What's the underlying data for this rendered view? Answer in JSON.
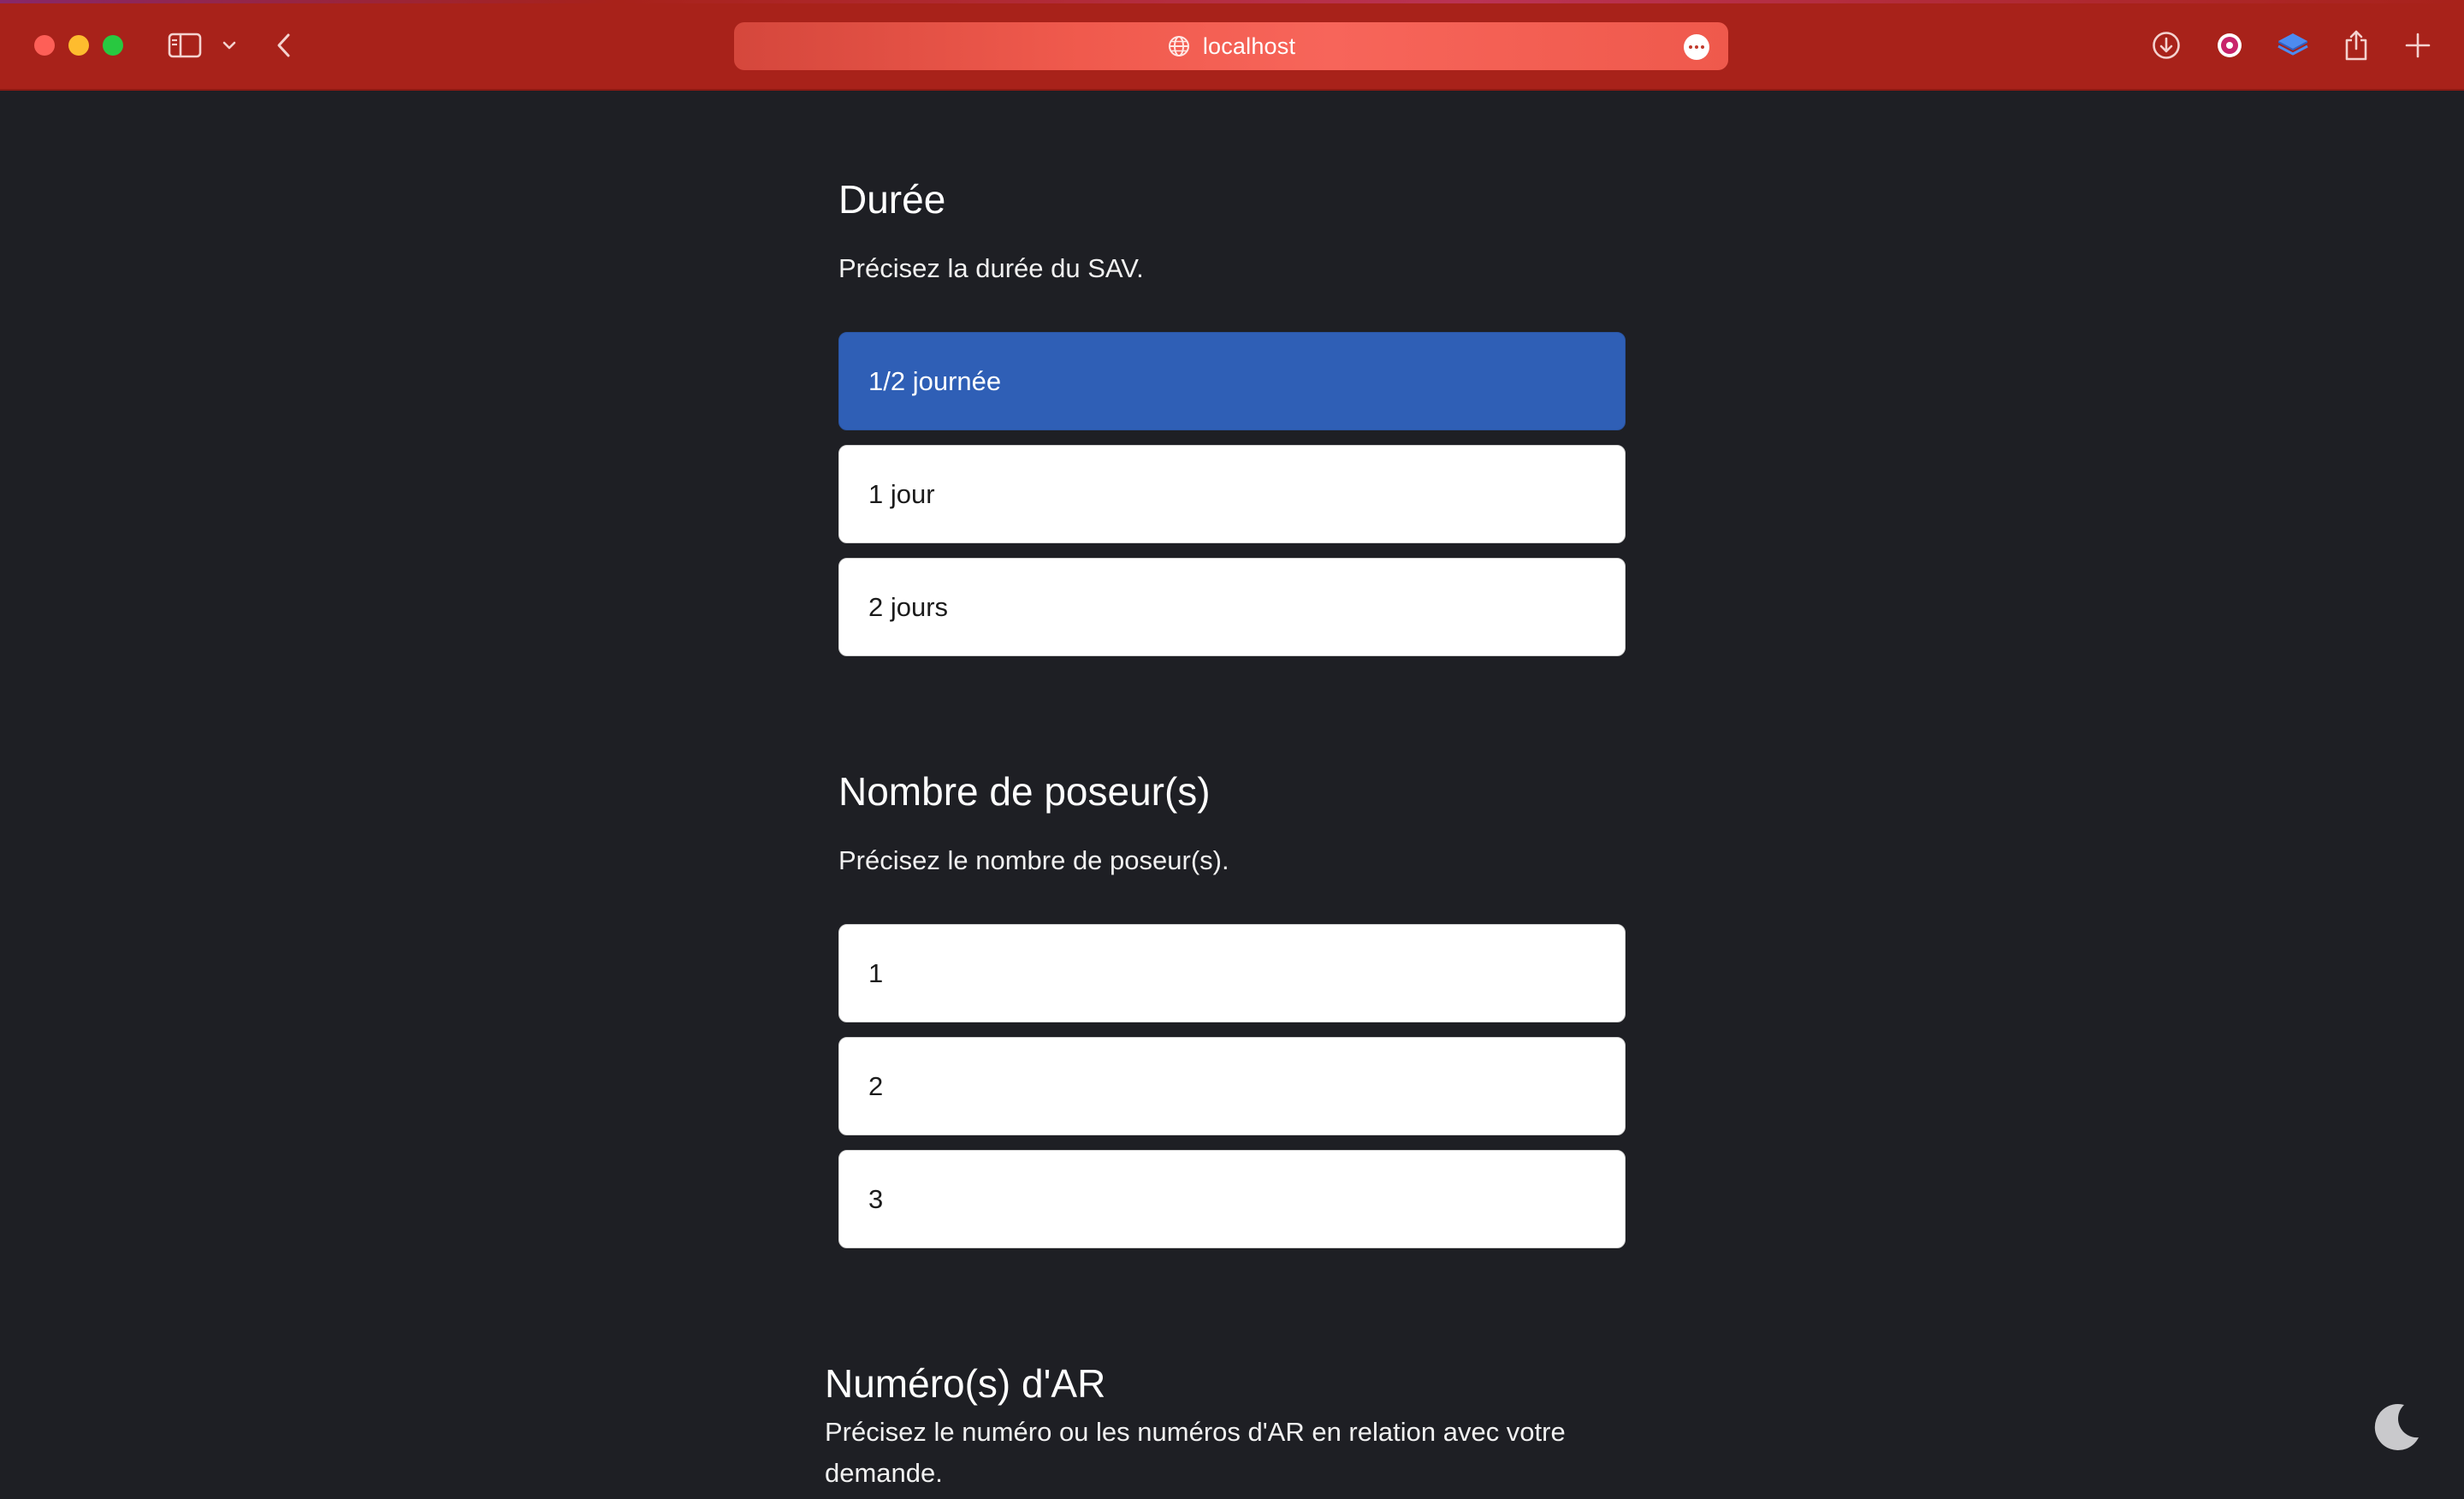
{
  "browser": {
    "url": "localhost",
    "icons": [
      "sidebar-icon",
      "chevron-down-icon",
      "back-icon",
      "globe-icon",
      "more-icon",
      "download-icon",
      "extension-icon",
      "layers-icon",
      "share-icon",
      "plus-icon"
    ]
  },
  "duree": {
    "title": "Durée",
    "description": "Précisez la durée du SAV.",
    "options": [
      "1/2 journée",
      "1 jour",
      "2 jours"
    ],
    "selected": "1/2 journée"
  },
  "poseurs": {
    "title": "Nombre de poseur(s)",
    "description": "Précisez le nombre de poseur(s).",
    "options": [
      "1",
      "2",
      "3"
    ]
  },
  "ar": {
    "title": "Numéro(s) d'AR",
    "description_line1": "Précisez le numéro ou les numéros d'AR en relation avec votre",
    "description_line2": "demande."
  },
  "theme_toggle": {
    "icon": "moon-icon"
  },
  "colors": {
    "chrome": "#a8221a",
    "page_bg": "#1e1f24",
    "selected_option": "#2f5fb6"
  }
}
